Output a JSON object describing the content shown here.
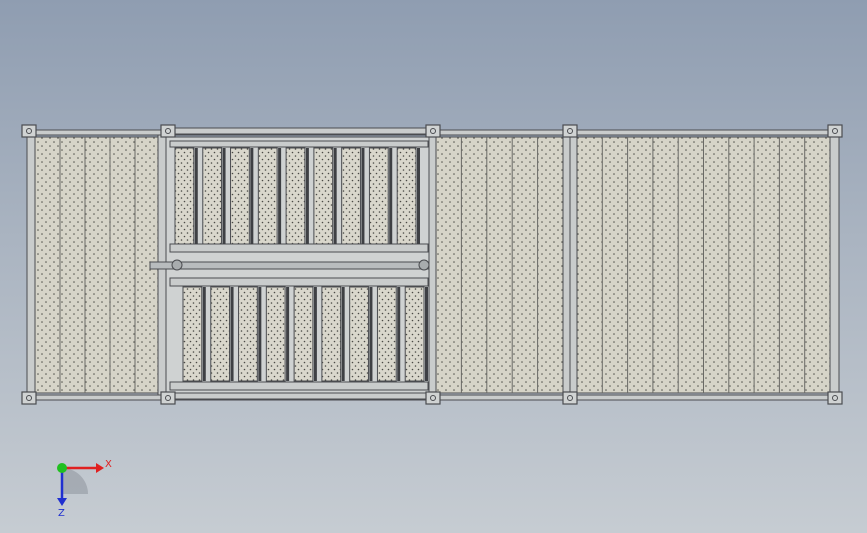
{
  "viewport": {
    "background_top": "#8f9db1",
    "background_bottom": "#c6ccd2"
  },
  "model": {
    "name": "platform-assembly",
    "plate_color": "#d6d4c8",
    "frame_color": "#4a4c50",
    "frame_fill": "#c9cccc",
    "perforation_color": "#4a4a46",
    "sections": [
      {
        "id": "left-deck",
        "panels": 5
      },
      {
        "id": "center-gate-upper",
        "slats": 9
      },
      {
        "id": "center-gate-lower",
        "slats": 9
      },
      {
        "id": "right-deck-a",
        "panels": 5
      },
      {
        "id": "right-deck-b",
        "panels": 10
      }
    ]
  },
  "triad": {
    "x_label": "X",
    "z_label": "Z",
    "x_color": "#e02020",
    "y_color": "#20c020",
    "z_color": "#2030d0"
  }
}
